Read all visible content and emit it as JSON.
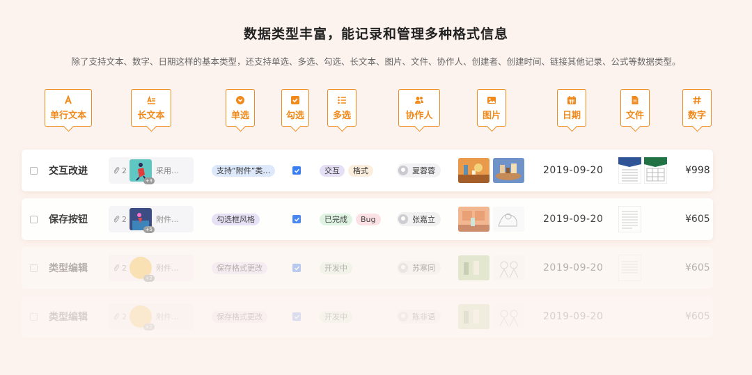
{
  "header": {
    "title": "数据类型丰富，能记录和管理多种格式信息",
    "subtitle": "除了支持文本、数字、日期这样的基本类型，还支持单选、多选、勾选、长文本、图片、文件、协作人、创建者、创建时间、链接其他记录、公式等数据类型。"
  },
  "types": [
    {
      "label": "单行文本",
      "icon": "text-a-icon"
    },
    {
      "label": "长文本",
      "icon": "long-text-icon"
    },
    {
      "label": "单选",
      "icon": "single-select-icon"
    },
    {
      "label": "勾选",
      "icon": "checkbox-icon"
    },
    {
      "label": "多选",
      "icon": "multi-select-icon"
    },
    {
      "label": "协作人",
      "icon": "people-icon"
    },
    {
      "label": "图片",
      "icon": "image-icon"
    },
    {
      "label": "日期",
      "icon": "calendar-icon"
    },
    {
      "label": "文件",
      "icon": "file-icon"
    },
    {
      "label": "数字",
      "icon": "hash-icon"
    }
  ],
  "colors": {
    "accent": "#f08a1c",
    "check": "#3b7ef0",
    "background": "#fdf3ee"
  },
  "rows": [
    {
      "name": "交互改进",
      "attach_count": "2",
      "longtext": "采用…",
      "thumb_badge": "+3",
      "single": "支持“附件”类…",
      "multi": [
        "交互",
        "格式"
      ],
      "person": "夏蓉蓉",
      "date": "2019-09-20",
      "number": "¥998"
    },
    {
      "name": "保存按钮",
      "attach_count": "2",
      "longtext": "附件…",
      "thumb_badge": "+5",
      "single": "勾选框风格",
      "multi": [
        "已完成",
        "Bug"
      ],
      "person": "张嘉立",
      "date": "2019-09-20",
      "number": "¥605"
    },
    {
      "name": "类型编辑",
      "attach_count": "2",
      "longtext": "附件…",
      "thumb_badge": "+2",
      "single": "保存格式更改",
      "multi": [
        "开发中"
      ],
      "person": "苏寒同",
      "date": "2019-09-20",
      "number": "¥605"
    },
    {
      "name": "类型编辑",
      "attach_count": "2",
      "longtext": "附件…",
      "thumb_badge": "+2",
      "single": "保存格式更改",
      "multi": [
        "开发中"
      ],
      "person": "陈非语",
      "date": "2019-09-20",
      "number": "¥605"
    }
  ]
}
